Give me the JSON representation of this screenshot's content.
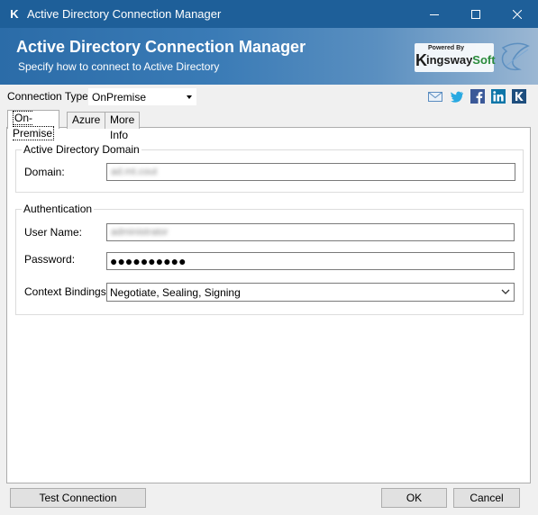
{
  "window": {
    "title": "Active Directory Connection Manager",
    "app_icon_letter": "K"
  },
  "header": {
    "title": "Active Directory Connection Manager",
    "subtitle": "Specify how to connect to Active Directory",
    "logo": {
      "powered_by": "Powered By",
      "k": "K",
      "brand_main": "ingsway",
      "brand_accent": "Soft"
    }
  },
  "connection_type": {
    "label": "Connection Type:",
    "value": "OnPremise"
  },
  "social_icons": [
    "email-icon",
    "twitter-icon",
    "facebook-icon",
    "linkedin-icon",
    "kingswaysoft-icon"
  ],
  "tabs": [
    {
      "label": "On-Premise",
      "active": true
    },
    {
      "label": "Azure",
      "active": false
    },
    {
      "label": "More Info",
      "active": false
    }
  ],
  "ad_domain_group": {
    "legend": "Active Directory Domain",
    "domain_label": "Domain:",
    "domain_value": "ad.mt.cout"
  },
  "auth_group": {
    "legend": "Authentication",
    "username_label": "User Name:",
    "username_value": "administrator",
    "password_label": "Password:",
    "password_value": "●●●●●●●●●●",
    "context_label": "Context Bindings:",
    "context_value": "Negotiate, Sealing, Signing"
  },
  "buttons": {
    "test_connection": "Test Connection",
    "ok": "OK",
    "cancel": "Cancel"
  },
  "colors": {
    "titlebar": "#1e5f99",
    "header_start": "#2b6ca8",
    "brand_green": "#2a8b3c"
  }
}
